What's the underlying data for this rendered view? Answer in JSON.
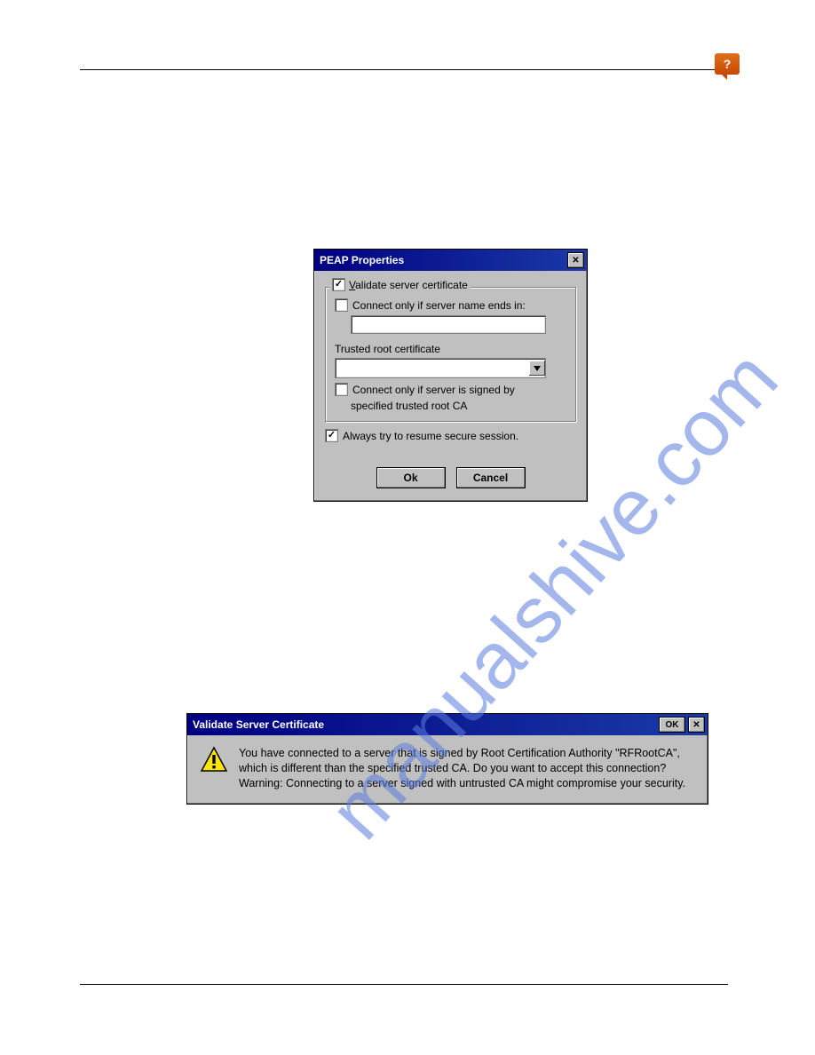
{
  "watermark_text": "manualshive.com",
  "dialog1": {
    "title": "PEAP Properties",
    "validate_label": "alidate server certificate",
    "validate_first": "V",
    "connect_name_label": "Connect only if server name ends in:",
    "trusted_root_label": "Trusted root certificate",
    "connect_signed_label1": "Connect only if server is signed by",
    "connect_signed_label2": "specified trusted root CA",
    "resume_label": "Always try to resume secure session.",
    "ok": "Ok",
    "cancel": "Cancel"
  },
  "dialog2": {
    "title": "Validate Server Certificate",
    "ok": "OK",
    "msg1": "You have connected to a server that is signed by Root Certification Authority \"RFRootCA\", which is different than the specified trusted CA.  Do you want to accept this connection?",
    "msg2": "Warning: Connecting to a server signed with untrusted CA might compromise your security."
  }
}
